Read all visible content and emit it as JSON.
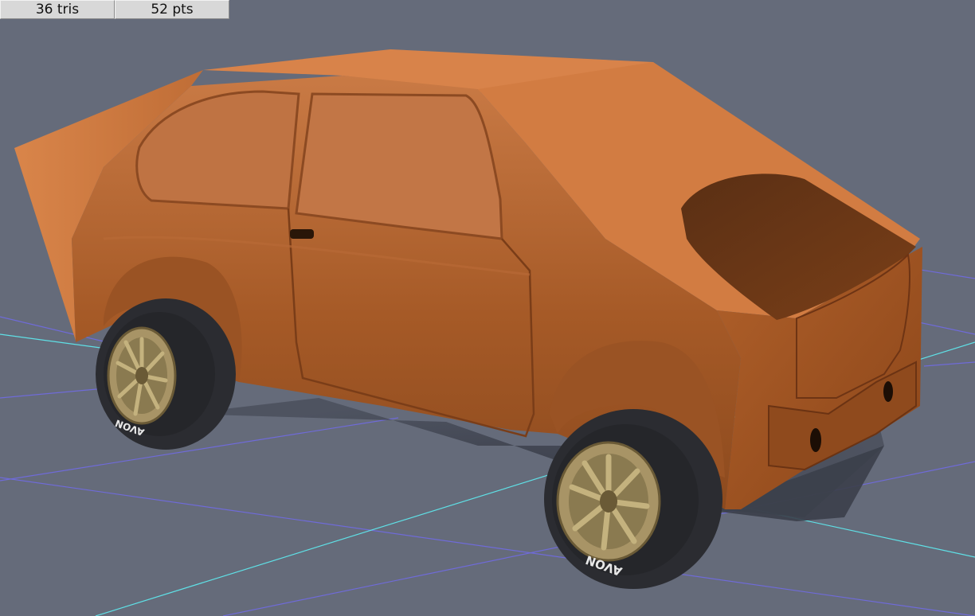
{
  "viewport_stats": {
    "tris": "36 tris",
    "pts": "52 pts"
  },
  "tire": {
    "brand": "AVON"
  },
  "colors": {
    "background": "#656b7a",
    "car_body": "#d47a3e",
    "grid_cyan": "#5fe0e6",
    "grid_blue": "#6f6bd8",
    "tire": "#2b2c31",
    "rim": "#a89466"
  }
}
